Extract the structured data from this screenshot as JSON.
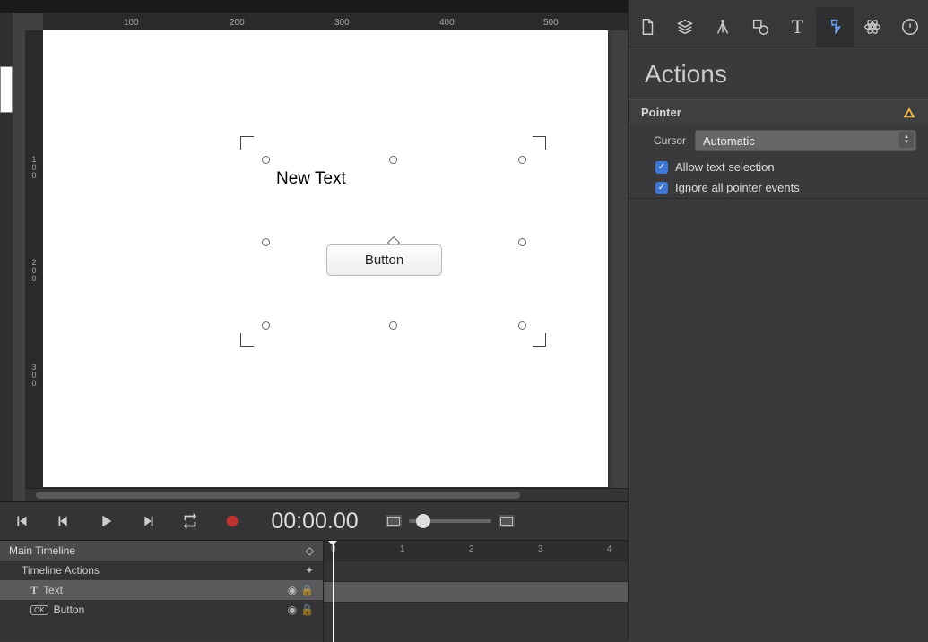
{
  "ruler_h": [
    "100",
    "200",
    "300",
    "400",
    "500"
  ],
  "ruler_v": [
    "100",
    "200",
    "300"
  ],
  "canvas": {
    "new_text": "New Text",
    "button_label": "Button"
  },
  "transport": {
    "timecode": "00:00.00"
  },
  "timeline": {
    "main": "Main Timeline",
    "actions": "Timeline Actions",
    "text_layer": "Text",
    "button_layer": "Button",
    "marks": [
      "0",
      "1",
      "2",
      "3",
      "4"
    ]
  },
  "inspector": {
    "title": "Actions",
    "section": "Pointer",
    "cursor_label": "Cursor",
    "cursor_value": "Automatic",
    "allow_select": "Allow text selection",
    "ignore_events": "Ignore all pointer events"
  }
}
